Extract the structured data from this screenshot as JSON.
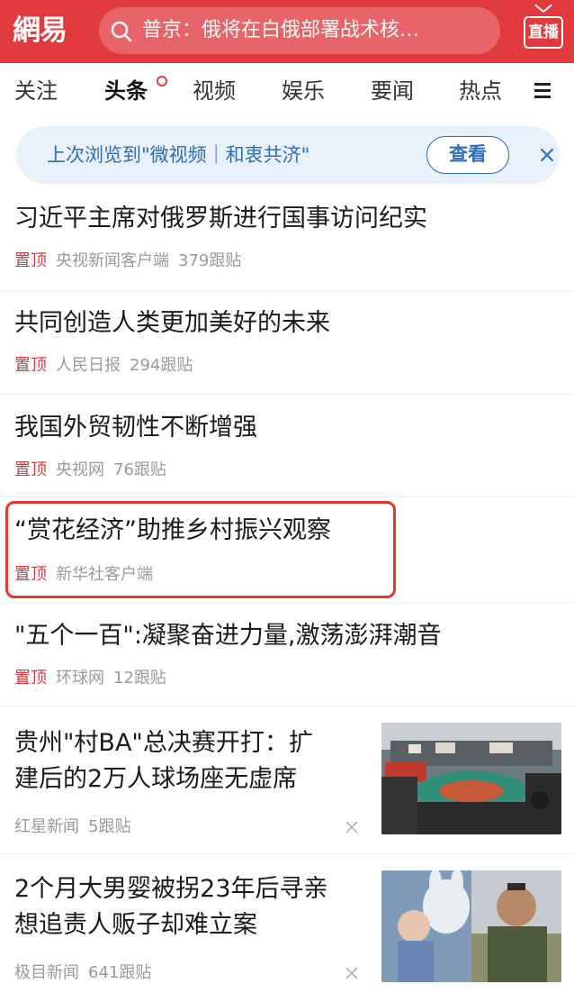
{
  "header": {
    "logo": "網易",
    "search_text": "普京：俄将在白俄部署战术核…",
    "live_label": "直播"
  },
  "tabs": [
    {
      "label": "关注"
    },
    {
      "label": "头条"
    },
    {
      "label": "视频"
    },
    {
      "label": "娱乐"
    },
    {
      "label": "要闻"
    },
    {
      "label": "热点"
    }
  ],
  "banner": {
    "text": "上次浏览到\"微视频｜和衷共济\"",
    "button_label": "查看"
  },
  "news": [
    {
      "title": "习近平主席对俄罗斯进行国事访问纪实",
      "pin": "置顶",
      "source": "央视新闻客户端",
      "comments": "379跟贴"
    },
    {
      "title": "共同创造人类更加美好的未来",
      "pin": "置顶",
      "source": "人民日报",
      "comments": "294跟贴"
    },
    {
      "title": "我国外贸韧性不断增强",
      "pin": "置顶",
      "source": "央视网",
      "comments": "76跟贴"
    },
    {
      "title": "“赏花经济”助推乡村振兴观察",
      "pin": "置顶",
      "source": "新华社客户端",
      "comments": ""
    },
    {
      "title": "\"五个一百\":凝聚奋进力量,激荡澎湃潮音",
      "pin": "置顶",
      "source": "环球网",
      "comments": "12跟贴"
    },
    {
      "title_line1": "贵州\"村BA\"总决赛开打：扩",
      "title_line2": "建后的2万人球场座无虚席",
      "source": "红星新闻",
      "comments": "5跟贴"
    },
    {
      "title_line1": "2个月大男婴被拐23年后寻亲",
      "title_line2": "想追责人贩子却难立案",
      "source": "极目新闻",
      "comments": "641跟贴"
    }
  ],
  "colors": {
    "brand_red": "#e03a3e",
    "banner_blue": "#2f6db5",
    "meta_gray": "#9a9a9a"
  }
}
